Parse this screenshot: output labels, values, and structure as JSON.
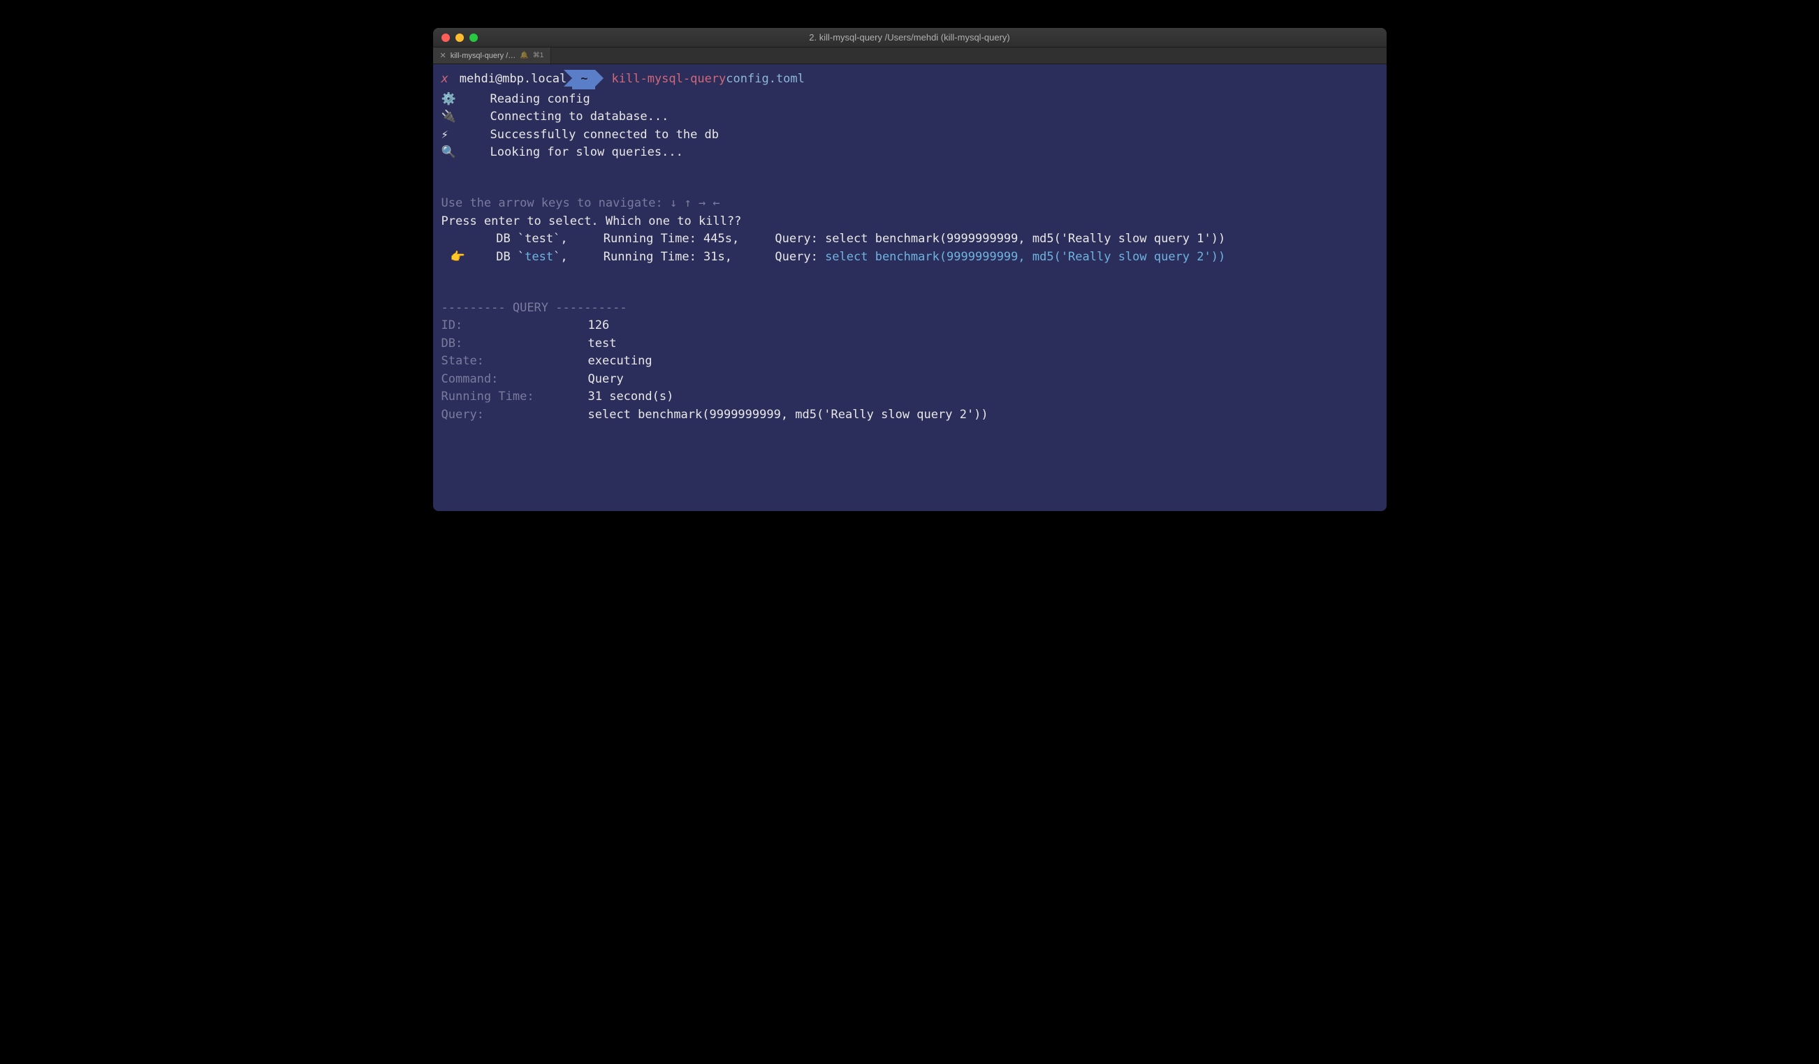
{
  "window": {
    "title": "2. kill-mysql-query  /Users/mehdi (kill-mysql-query)",
    "tab": {
      "label": "kill-mysql-query  /…",
      "shortcut": "⌘1"
    }
  },
  "prompt": {
    "x": "x",
    "user_host": "mehdi@mbp.local",
    "cwd": "~",
    "command": "kill-mysql-query",
    "arg": "config.toml"
  },
  "status": [
    {
      "icon": "⚙️",
      "text": "Reading config"
    },
    {
      "icon": "🔌",
      "text": "Connecting to database..."
    },
    {
      "icon": "⚡",
      "text": "Successfully connected to the db"
    },
    {
      "icon": "🔍",
      "text": "Looking for slow queries..."
    }
  ],
  "nav_hint": "Use the arrow keys to navigate: ↓ ↑ → ←",
  "select_prompt": "Press enter to select. Which one to kill??",
  "queries": [
    {
      "selected": false,
      "pointer": "",
      "db": "test",
      "running_time": "445s",
      "query": "select benchmark(9999999999, md5('Really slow query 1'))"
    },
    {
      "selected": true,
      "pointer": "👉",
      "db": "test",
      "running_time": "31s",
      "query": "select benchmark(9999999999, md5('Really slow query 2'))"
    }
  ],
  "section_header": "--------- QUERY ----------",
  "details": {
    "id_label": "ID:",
    "id": "126",
    "db_label": "DB:",
    "db": "test",
    "state_label": "State:",
    "state": "executing",
    "command_label": "Command:",
    "command": "Query",
    "rt_label": "Running Time:",
    "rt": "31 second(s)",
    "query_label": "Query:",
    "query": "select benchmark(9999999999, md5('Really slow query 2'))"
  }
}
